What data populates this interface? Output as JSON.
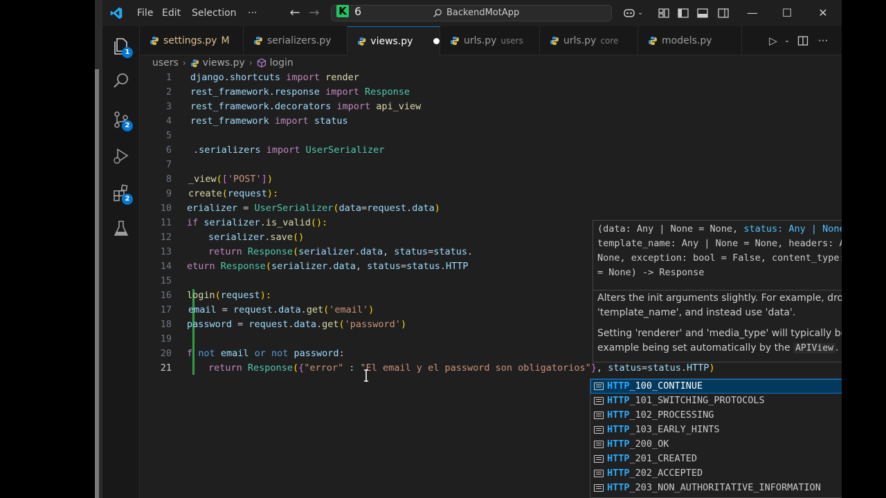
{
  "titlebar": {
    "menus": [
      "File",
      "Edit",
      "Selection",
      "···"
    ],
    "badge_count": "6",
    "search_text": "BackendMotApp"
  },
  "activity": {
    "explorer_badge": "1",
    "scm_badge": "2",
    "extensions_badge": "2"
  },
  "tabs": [
    {
      "label": "settings.py",
      "mod": "M"
    },
    {
      "label": "serializers.py"
    },
    {
      "label": "views.py"
    },
    {
      "label": "urls.py",
      "desc": "users"
    },
    {
      "label": "urls.py",
      "desc": "core"
    },
    {
      "label": "models.py"
    }
  ],
  "breadcrumb": [
    "users",
    "views.py",
    "login"
  ],
  "line_numbers": [
    "1",
    "2",
    "3",
    "4",
    "5",
    "6",
    "7",
    "8",
    "9",
    "10",
    "11",
    "12",
    "13",
    "14",
    "15",
    "16",
    "17",
    "18",
    "19",
    "20",
    "21"
  ],
  "signature": {
    "text_pre": "(data: Any | None = None, ",
    "text_hl": "status: Any | None = None",
    "text_post": ",\ntemplate_name: Any | None = None, headers: Any | None =\nNone, exception: bool = False, content_type: Any | None\n= None) -> Response",
    "doc1": "Alters the init arguments slightly. For example, drop 'template_name', and instead use 'data'.",
    "doc2_pre": "Setting 'renderer' and 'media_type' will typically be deferred, For example being set automatically by the ",
    "doc2_code": "APIView",
    "doc2_post": "."
  },
  "suggestions": [
    {
      "match": "HTTP",
      "rest": "_100_CONTINUE"
    },
    {
      "match": "HTTP",
      "rest": "_101_SWITCHING_PROTOCOLS"
    },
    {
      "match": "HTTP",
      "rest": "_102_PROCESSING"
    },
    {
      "match": "HTTP",
      "rest": "_103_EARLY_HINTS"
    },
    {
      "match": "HTTP",
      "rest": "_200_OK"
    },
    {
      "match": "HTTP",
      "rest": "_201_CREATED"
    },
    {
      "match": "HTTP",
      "rest": "_202_ACCEPTED"
    },
    {
      "match": "HTTP",
      "rest": "_203_NON_AUTHORITATIVE_INFORMATION"
    }
  ],
  "code": {
    "l1": [
      "django.shortcuts",
      "import",
      "render"
    ],
    "l2": [
      "rest_framework.response",
      "import",
      "Response"
    ],
    "l3": [
      "rest_framework.decorators",
      "import",
      "api_view"
    ],
    "l4": [
      "rest_framework",
      "import",
      "status"
    ],
    "l6": [
      ".serializers",
      "import",
      "UserSerializer"
    ],
    "l8": [
      "_view",
      "(",
      "[",
      "'POST'",
      "]",
      ")"
    ],
    "l9": [
      "create",
      "(",
      "request",
      "):"
    ],
    "l10": [
      "erializer",
      " = ",
      "UserSerializer",
      "(",
      "data",
      "=",
      "request",
      ".",
      "data",
      ")"
    ],
    "l11": [
      "if",
      " ",
      "serializer",
      ".",
      "is_valid",
      "():"
    ],
    "l12": [
      "serializer",
      ".",
      "save",
      "()"
    ],
    "l13": [
      "return",
      " ",
      "Response",
      "(",
      "serializer",
      ".",
      "data",
      ", ",
      "status",
      "=",
      "status",
      "."
    ],
    "l14": [
      "eturn",
      " ",
      "Response",
      "(",
      "serializer",
      ".",
      "data",
      ", ",
      "status",
      "=",
      "status",
      ".",
      "HTTP"
    ],
    "l16": [
      "login",
      "(",
      "request",
      "):"
    ],
    "l17": [
      "email",
      " = ",
      "request",
      ".",
      "data",
      ".",
      "get",
      "(",
      "'email'",
      ")"
    ],
    "l18": [
      "password",
      " = ",
      "request",
      ".",
      "data",
      ".",
      "get",
      "(",
      "'password'",
      ")"
    ],
    "l20": [
      "f",
      " ",
      "not",
      " ",
      "email",
      " ",
      "or",
      " ",
      "not",
      " ",
      "password",
      ":"
    ],
    "l21": [
      "return",
      " ",
      "Response",
      "(",
      "{",
      "\"error\"",
      " : ",
      "\"El email y el password son obligatorios\"",
      "}",
      ", ",
      "status",
      "=",
      "status",
      ".",
      "HTTP",
      ")"
    ]
  }
}
